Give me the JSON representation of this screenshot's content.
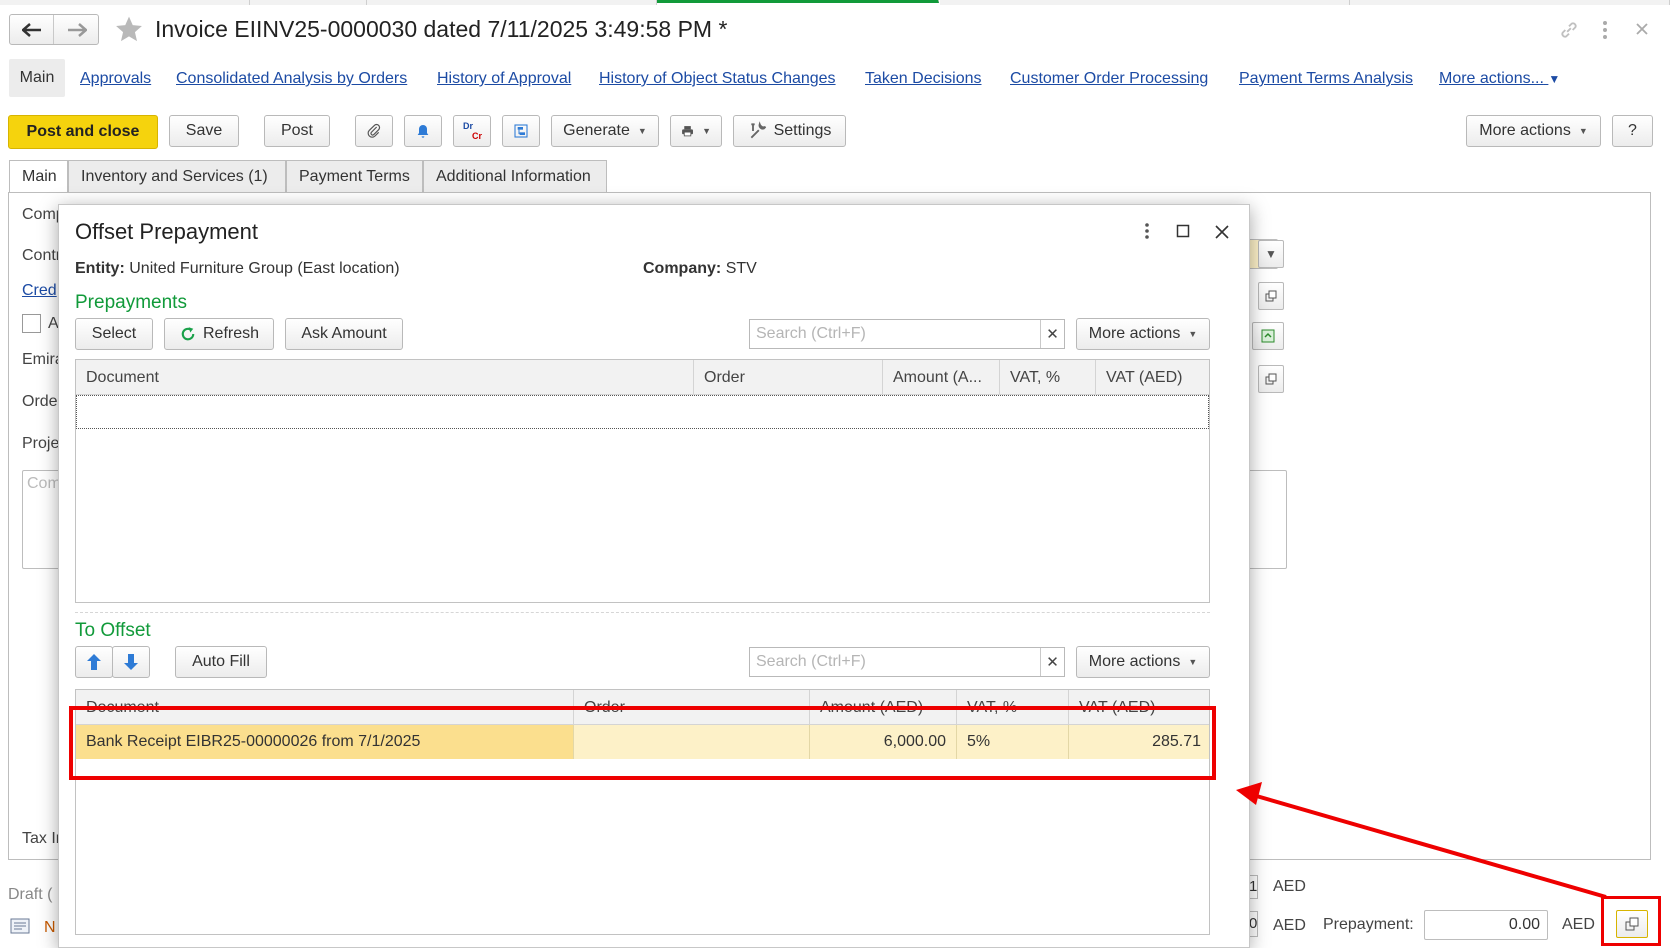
{
  "window": {
    "title": "Invoice EIINV25-0000030 dated 7/11/2025 3:49:58 PM *"
  },
  "nav": {
    "main_label": "Main",
    "links": [
      "Approvals",
      "Consolidated Analysis by Orders",
      "History of Approval",
      "History of Object Status Changes",
      "Taken Decisions",
      "Customer Order Processing",
      "Payment Terms Analysis",
      "More actions..."
    ]
  },
  "toolbar": {
    "post_and_close": "Post and close",
    "save": "Save",
    "post": "Post",
    "dr": "Dr",
    "cr": "Cr",
    "generate": "Generate",
    "settings": "Settings",
    "more_actions": "More actions",
    "help": "?"
  },
  "tabs": [
    "Main",
    "Inventory and Services (1)",
    "Payment Terms",
    "Additional Information"
  ],
  "background_form": {
    "labels": [
      "Comp",
      "Contr",
      "Cred",
      "A",
      "Emira",
      "Orde",
      "Proje",
      "Com",
      "Tax In"
    ],
    "footer": {
      "draft": "Draft (",
      "n_label": "N",
      "aed1": "AED",
      "aed2": "AED",
      "value1": "1",
      "value2": "0",
      "prepayment_label": "Prepayment:",
      "prepayment_value": "0.00",
      "prepayment_currency": "AED"
    }
  },
  "modal": {
    "title": "Offset Prepayment",
    "entity_label": "Entity:",
    "entity_value": "United Furniture Group (East location)",
    "company_label": "Company:",
    "company_value": "STV",
    "prepayments": {
      "title": "Prepayments",
      "select": "Select",
      "refresh": "Refresh",
      "ask_amount": "Ask Amount",
      "search_placeholder": "Search (Ctrl+F)",
      "more_actions": "More actions",
      "columns": [
        "Document",
        "Order",
        "Amount (A...",
        "VAT, %",
        "VAT (AED)"
      ]
    },
    "to_offset": {
      "title": "To Offset",
      "auto_fill": "Auto Fill",
      "search_placeholder": "Search (Ctrl+F)",
      "more_actions": "More actions",
      "columns": [
        "Document",
        "Order",
        "Amount (AED)",
        "VAT, %",
        "VAT (AED)"
      ],
      "rows": [
        {
          "document": "Bank Receipt EIBR25-00000026 from 7/1/2025",
          "order": "",
          "amount": "6,000.00",
          "vat_pct": "5%",
          "vat": "285.71"
        }
      ]
    }
  },
  "colors": {
    "accent_yellow": "#f5d30d",
    "section_green": "#119a3a",
    "link_blue": "#1c4ba4",
    "highlight_red": "#ee0000",
    "row_selected": "#fbdf8e",
    "row_cell": "#fdf1c8"
  }
}
